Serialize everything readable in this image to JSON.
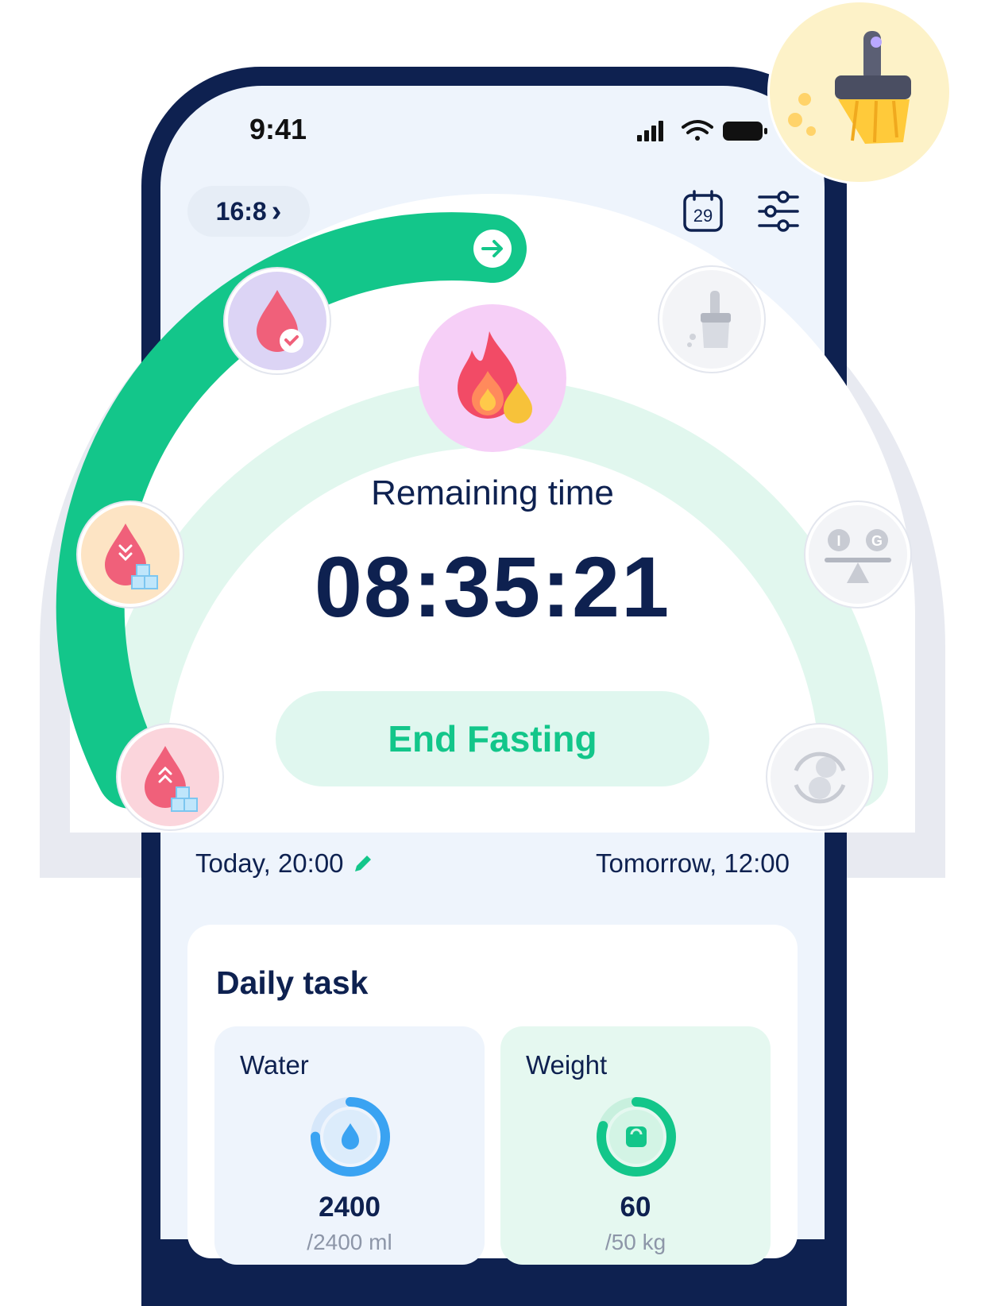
{
  "status_bar": {
    "time": "9:41"
  },
  "header": {
    "plan_label": "16:8",
    "plan_chevron": "›",
    "calendar_day": "29"
  },
  "timer": {
    "label": "Remaining time",
    "value": "08:35:21",
    "progress_fraction": 0.6,
    "button_label": "End Fasting"
  },
  "schedule": {
    "start": "Today, 20:00",
    "end": "Tomorrow, 12:00"
  },
  "daily_task": {
    "title": "Daily task",
    "water": {
      "label": "Water",
      "value": "2400",
      "sub": "/2400 ml",
      "progress_fraction": 0.75
    },
    "weight": {
      "label": "Weight",
      "value": "60",
      "sub": "/50 kg",
      "progress_fraction": 0.8
    }
  },
  "stages": [
    {
      "name": "blood-sugar-rise",
      "state": "done"
    },
    {
      "name": "blood-sugar-fall",
      "state": "done"
    },
    {
      "name": "blood-sugar-normal",
      "state": "done"
    },
    {
      "name": "fat-burning",
      "state": "current"
    },
    {
      "name": "autophagy",
      "state": "locked"
    },
    {
      "name": "insulin-glucagon",
      "state": "locked"
    },
    {
      "name": "cell-renewal",
      "state": "locked"
    }
  ],
  "colors": {
    "navy": "#0e2150",
    "green": "#13c68a",
    "green_light": "#e0f7ef",
    "screen_bg": "#eef4fc"
  }
}
